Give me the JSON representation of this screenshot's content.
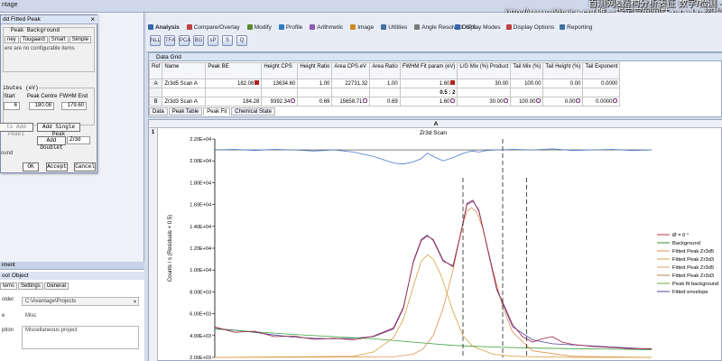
{
  "titlebar": {
    "title": "ntage"
  },
  "watermark": {
    "line1": "百测网&结构分析表征 数字/检测 -",
    "line2": "http://www.zkbaice.cn/ 唯一指定官网网站 o t e l o 咨询"
  },
  "dialog": {
    "title": "dd Fitted Peak",
    "group_title": "Peak Background",
    "tabs": [
      "ney",
      "Tougaard",
      "Smart",
      "Simple"
    ],
    "message": "ere are no configurable items",
    "attrs_title": "ibutes (eV)",
    "col_start": "Start",
    "col_centre": "Peak Centre",
    "col_fwhm": "FWHM End",
    "val_start": "6",
    "val_centre": "180.08",
    "val_fwhm": "179.60",
    "btn_add_peaks": "ts Add Peaks",
    "btn_add_single": "Add Single Peak",
    "btn_add_doublet": "Add Doublet",
    "doublet_value": "Zr3d",
    "bound_label": "ound",
    "btn_ok": "OK",
    "btn_accept": "Accept",
    "btn_cancel": "Cancel"
  },
  "props": {
    "expander": "iment",
    "header": "oot Object",
    "tabs": [
      "tems",
      "Settings",
      "General"
    ],
    "folder_label": "older",
    "folder_value": "C:\\Avantage\\Projects",
    "ne_label": "e",
    "ne_value": "Misc",
    "desc_label": "ption",
    "desc_value": "Miscellaneous project"
  },
  "ribbon": {
    "tabs": [
      {
        "label": "Analysis",
        "color": "#3466b0"
      },
      {
        "label": "Compare/Overlay",
        "color": "#c04040"
      },
      {
        "label": "Modify",
        "color": "#5a8a30"
      },
      {
        "label": "Profile",
        "color": "#2c7bbf"
      },
      {
        "label": "Arithmetic",
        "color": "#8a5cb0"
      },
      {
        "label": "Image",
        "color": "#d08a20"
      },
      {
        "label": "Utilities",
        "color": "#4070a0"
      },
      {
        "label": "Angle Resolved XPS",
        "color": "#7a7a7a"
      }
    ],
    "right_tabs": [
      {
        "label": "Display Modes",
        "color": "#3466b0"
      },
      {
        "label": "Display Options",
        "color": "#c04040"
      },
      {
        "label": "Reporting",
        "color": "#4070a0"
      }
    ],
    "icons": [
      "NLLSF",
      "TFA",
      "PCA",
      "BG",
      "sP",
      "S",
      "Q"
    ]
  },
  "grid": {
    "header": "Data Grid",
    "columns": [
      "Ref",
      "Name",
      "Peak BE",
      "Height CPS",
      "Height Ratio",
      "Area CPS.eV",
      "Area Ratio",
      "FWHM Fit param (eV)",
      "L/G Mix (%) Product",
      "Tail Mix (%)",
      "Tail Height (%)",
      "Tail Exponent"
    ],
    "rows": [
      {
        "ref": "A",
        "name": "Zr3d5 Scan A",
        "be": "182.08",
        "height": "13634.60",
        "hratio": "1.00",
        "area": "22731.32",
        "aratio": "1.00",
        "fwhm": "1.60",
        "lg": "30.00",
        "tmix": "100.00",
        "theight": "0.00",
        "texp": "0.0000"
      },
      {
        "ref": "",
        "name": "",
        "be": "",
        "height": "",
        "hratio": "",
        "area": "",
        "aratio": "",
        "fwhm": "0.5 : 2",
        "lg": "",
        "tmix": "",
        "theight": "",
        "texp": ""
      },
      {
        "ref": "B",
        "name": "Zr3d3 Scan A",
        "be": "184.28",
        "height": "9392.34",
        "hratio": "0.69",
        "area": "15658.71",
        "aratio": "0.69",
        "fwhm": "1.60",
        "lg": "30.00",
        "tmix": "100.00",
        "theight": "0.00",
        "texp": "0.0000"
      }
    ],
    "subtabs": [
      "Data",
      "Peak Table",
      "Peak Fit",
      "Chemical State"
    ]
  },
  "chart": {
    "col_header": "A",
    "row_header": "1"
  },
  "chart_data": {
    "type": "line",
    "title": "Zr3d Scan",
    "ylabel": "Counts / s  (Residuals × 0.5)",
    "y_ticks": [
      "2.20E+04",
      "2.00E+04",
      "1.80E+04",
      "1.60E+04",
      "1.40E+04",
      "1.20E+04",
      "1.00E+04",
      "8.00E+03",
      "6.00E+03",
      "4.00E+03",
      "2.00E+03"
    ],
    "ylim": [
      2000,
      22000
    ],
    "x_range_be": [
      195,
      173
    ],
    "legend": [
      "Ø = 0 °",
      "Background",
      "Fitted Peak Zr3d5",
      "Fitted Peak Zr3d3",
      "Fitted Peak Zr3d5",
      "Fitted Peak Zr3d3",
      "Peak fit background",
      "Fitted envelope"
    ],
    "legend_colors": [
      "#c0303a",
      "#3a8a3a",
      "#e09050",
      "#e0a040",
      "#d0a060",
      "#b08040",
      "#60b040",
      "#5040a0"
    ],
    "series": [
      {
        "name": "Fitted envelope",
        "x": [
          195,
          194,
          193,
          192,
          191,
          190,
          189,
          188,
          187,
          186,
          185.5,
          185,
          184.6,
          184.3,
          184,
          183.5,
          183,
          182.6,
          182.3,
          182,
          181.7,
          181.3,
          180.8,
          180,
          179,
          178,
          177,
          176,
          175,
          174,
          173
        ],
        "y": [
          4650,
          4500,
          4300,
          4050,
          3850,
          3750,
          3700,
          3750,
          3900,
          4600,
          6500,
          10800,
          12800,
          13200,
          12700,
          10800,
          10400,
          13500,
          16000,
          16300,
          15500,
          12200,
          8200,
          4800,
          3600,
          3250,
          3150,
          3050,
          2950,
          2850,
          2750
        ]
      },
      {
        "name": "Background",
        "x": [
          195,
          193,
          191,
          189,
          187,
          185,
          183,
          181,
          179,
          177,
          175,
          173
        ],
        "y": [
          4600,
          4350,
          4100,
          3900,
          3700,
          3400,
          3100,
          2950,
          2850,
          2800,
          2750,
          2700
        ]
      },
      {
        "name": "Fitted Peak Zr3d5",
        "x": [
          195,
          186,
          185,
          184.5,
          184,
          183.5,
          183,
          182.6,
          182.3,
          182.08,
          181.8,
          181.5,
          181,
          180.5,
          180,
          179,
          177,
          173
        ],
        "y": [
          2000,
          2050,
          2300,
          2800,
          4000,
          6500,
          10000,
          13600,
          15400,
          15700,
          15300,
          13800,
          10000,
          6600,
          4300,
          2600,
          2100,
          2000
        ]
      },
      {
        "name": "Fitted Peak Zr3d3",
        "x": [
          195,
          188,
          187,
          186,
          185.5,
          185,
          184.6,
          184.28,
          184,
          183.6,
          183,
          182.5,
          182,
          181,
          180,
          177,
          173
        ],
        "y": [
          2000,
          2100,
          2500,
          3800,
          5500,
          8500,
          10800,
          11400,
          11000,
          9500,
          6200,
          4000,
          3000,
          2300,
          2100,
          2000,
          2000
        ]
      },
      {
        "name": "Ø = 0 °",
        "x": [
          195,
          194,
          193,
          192,
          191,
          190,
          189,
          188,
          187,
          186,
          185.5,
          185,
          184.6,
          184.3,
          184,
          183.5,
          183,
          182.6,
          182.3,
          182,
          181.7,
          181.3,
          180.8,
          180,
          179.5,
          179,
          178.5,
          178,
          177.5,
          177,
          176,
          175,
          174,
          173
        ],
        "y": [
          4800,
          4300,
          4400,
          3900,
          3950,
          3650,
          3750,
          3600,
          3950,
          4700,
          6600,
          10700,
          12700,
          13100,
          12800,
          10900,
          10300,
          13400,
          16100,
          16400,
          15400,
          12300,
          8300,
          5000,
          3900,
          3400,
          3700,
          3900,
          3400,
          3200,
          3000,
          2900,
          2800,
          2800
        ]
      }
    ],
    "residuals": {
      "x": [
        195,
        194,
        193,
        192,
        191,
        190,
        189,
        188,
        187,
        186,
        185.5,
        185,
        184.6,
        184.3,
        184,
        183.5,
        183,
        182.6,
        182.3,
        182,
        181.7,
        181.3,
        180.8,
        180,
        179,
        178,
        177,
        176,
        175,
        174,
        173
      ],
      "y": [
        21000,
        21050,
        20950,
        21050,
        21000,
        20900,
        21000,
        20800,
        20400,
        19800,
        19700,
        19900,
        20200,
        20700,
        20400,
        20000,
        20300,
        20600,
        20800,
        20900,
        20800,
        20950,
        21000,
        21050,
        21000,
        21100,
        20950,
        21000,
        21050,
        20950,
        21000
      ]
    },
    "markers_be": [
      182.5,
      180.5,
      179.3
    ]
  }
}
